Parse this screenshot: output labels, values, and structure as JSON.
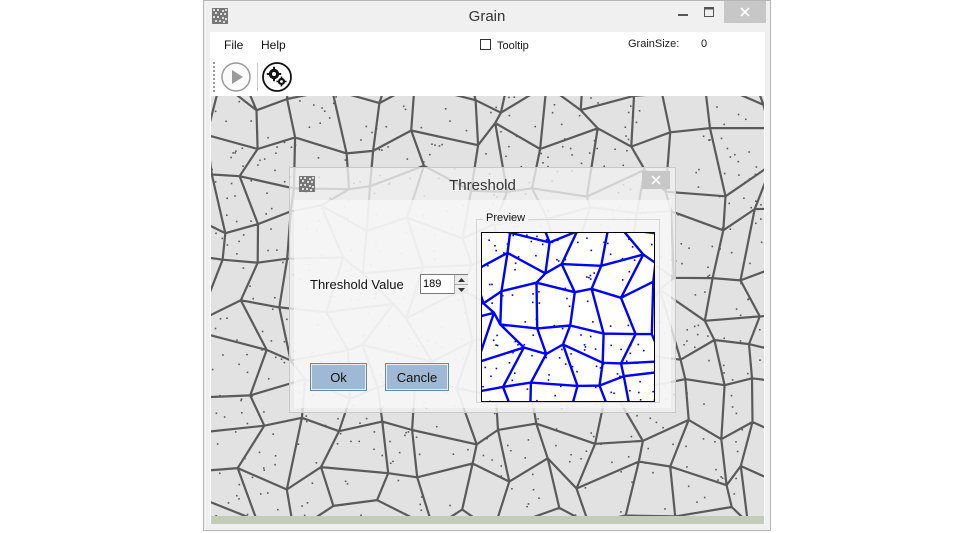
{
  "window": {
    "title": "Grain",
    "icon": "grain-texture-icon",
    "controls": [
      "minimize-icon",
      "maximize-icon",
      "close-icon"
    ]
  },
  "menu": {
    "file": "File",
    "help": "Help"
  },
  "header": {
    "tooltip_label": "Tooltip",
    "tooltip_checked": false,
    "grainsize_label": "GrainSize:",
    "grainsize_value": "0"
  },
  "toolbar": {
    "buttons": [
      "play-icon",
      "gears-icon"
    ]
  },
  "dialog": {
    "title": "Threshold",
    "threshold_label": "Threshold Value",
    "threshold_value": "189",
    "ok_label": "Ok",
    "cancel_label": "Cancle",
    "preview_label": "Preview"
  },
  "colors": {
    "preview_boundary": "#0000ff",
    "canvas_boundary": "#5a5a5a",
    "button_fill": "#9fb9d4"
  }
}
